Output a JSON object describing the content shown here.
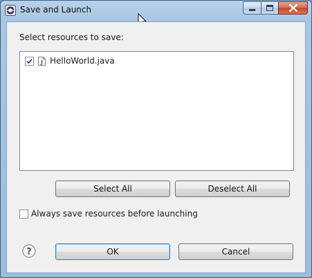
{
  "window": {
    "title": "Save and Launch",
    "caption_buttons": {
      "minimize": "minimize",
      "maximize": "maximize",
      "close": "close"
    }
  },
  "dialog": {
    "prompt": "Select resources to save:",
    "resources": [
      {
        "label": "HelloWorld.java",
        "checked": true,
        "icon": "java-file-icon"
      }
    ],
    "select_all_label": "Select All",
    "deselect_all_label": "Deselect All",
    "always_save_label": "Always save resources before launching",
    "always_save_checked": false,
    "ok_label": "OK",
    "cancel_label": "Cancel"
  },
  "colors": {
    "title_bar": "#a9c6e3",
    "client_bg": "#f0f0f0",
    "default_button_border": "#3c7fb1",
    "close_button": "#c2452b"
  }
}
